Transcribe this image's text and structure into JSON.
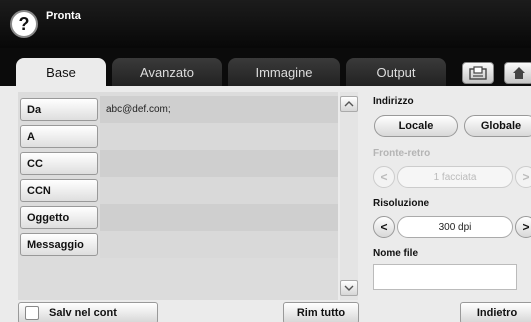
{
  "header": {
    "help_label": "?",
    "title": "Pronta"
  },
  "tabs": [
    {
      "label": "Base",
      "active": true
    },
    {
      "label": "Avanzato",
      "active": false
    },
    {
      "label": "Immagine",
      "active": false
    },
    {
      "label": "Output",
      "active": false
    }
  ],
  "toolbar": {
    "tool1_icon": "document-tray-icon",
    "tool2_icon": "home-icon"
  },
  "fields": [
    {
      "label": "Da",
      "value": "abc@def.com;"
    },
    {
      "label": "A",
      "value": ""
    },
    {
      "label": "CC",
      "value": ""
    },
    {
      "label": "CCN",
      "value": ""
    },
    {
      "label": "Oggetto",
      "value": ""
    },
    {
      "label": "Messaggio",
      "value": ""
    }
  ],
  "scroll": {
    "up": "^",
    "down": "v"
  },
  "address": {
    "label": "Indirizzo",
    "locale": "Locale",
    "globale": "Globale"
  },
  "duplex": {
    "label": "Fronte-retro",
    "value": "1 facciata",
    "prev": "<",
    "next": ">"
  },
  "resolution": {
    "label": "Risoluzione",
    "value": "300 dpi",
    "prev": "<",
    "next": ">"
  },
  "filename": {
    "label": "Nome file",
    "value": ""
  },
  "buttons": {
    "save_label": "Salv nel cont",
    "clear_label": "Rim tutto",
    "back_label": "Indietro"
  }
}
